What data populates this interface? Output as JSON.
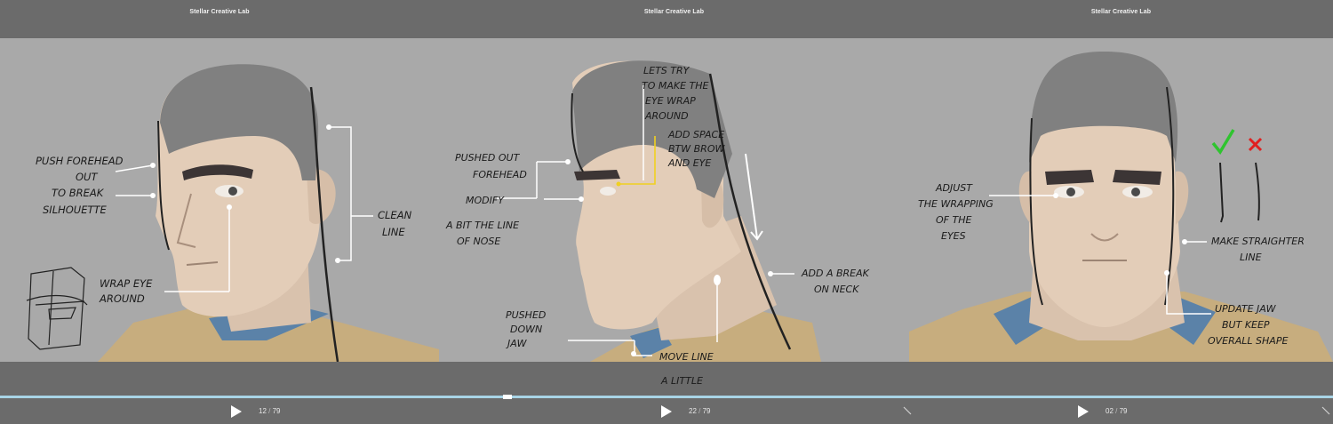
{
  "panels": [
    {
      "title": "Stellar Creative Lab",
      "frame_current": "12",
      "frame_total": "79",
      "notes": {
        "forehead": [
          "PUSH FOREHEAD",
          "OUT",
          "TO BREAK",
          "SILHOUETTE"
        ],
        "wrap_eye": [
          "WRAP EYE",
          "AROUND"
        ],
        "clean_line": [
          "CLEAN",
          "LINE"
        ]
      }
    },
    {
      "title": "Stellar Creative Lab",
      "frame_current": "22",
      "frame_total": "79",
      "notes": {
        "eye_wrap": [
          "LETS TRY",
          "TO MAKE THE",
          "EYE WRAP",
          "AROUND"
        ],
        "space": [
          "ADD SPACE",
          "BTW BROW",
          "AND EYE"
        ],
        "pushed_forehead": [
          "PUSHED OUT",
          "FOREHEAD"
        ],
        "modify": [
          "MODIFY",
          "A BIT THE LINE",
          "OF NOSE"
        ],
        "jaw": [
          "PUSHED",
          "DOWN",
          "JAW"
        ],
        "neck": [
          "ADD A BREAK",
          "ON NECK"
        ],
        "move": [
          "MOVE LINE",
          "A LITTLE"
        ]
      }
    },
    {
      "title": "Stellar Creative Lab",
      "frame_current": "02",
      "frame_total": "79",
      "notes": {
        "adjust": [
          "ADJUST",
          "THE WRAPPING",
          "OF THE",
          "EYES"
        ],
        "straighter": [
          "MAKE STRAIGHTER",
          "LINE"
        ],
        "update": [
          "UPDATE JAW",
          "BUT KEEP",
          "OVERALL SHAPE"
        ]
      }
    }
  ],
  "timeline": {
    "progress_markers": [
      "22 / 79"
    ]
  },
  "colors": {
    "chrome": "#6b6b6b",
    "viewport": "#a9a9a9",
    "skin": "#e3cdb8",
    "hair": "#808080",
    "shirt": "#c7ad7e",
    "collar": "#5b82a8",
    "timeline": "#a8d4e6",
    "check": "#2fc42f",
    "cross": "#e02020",
    "highlight": "#f0d020"
  },
  "icons": [
    "play-icon",
    "expand-icon",
    "check-icon",
    "cross-icon"
  ]
}
